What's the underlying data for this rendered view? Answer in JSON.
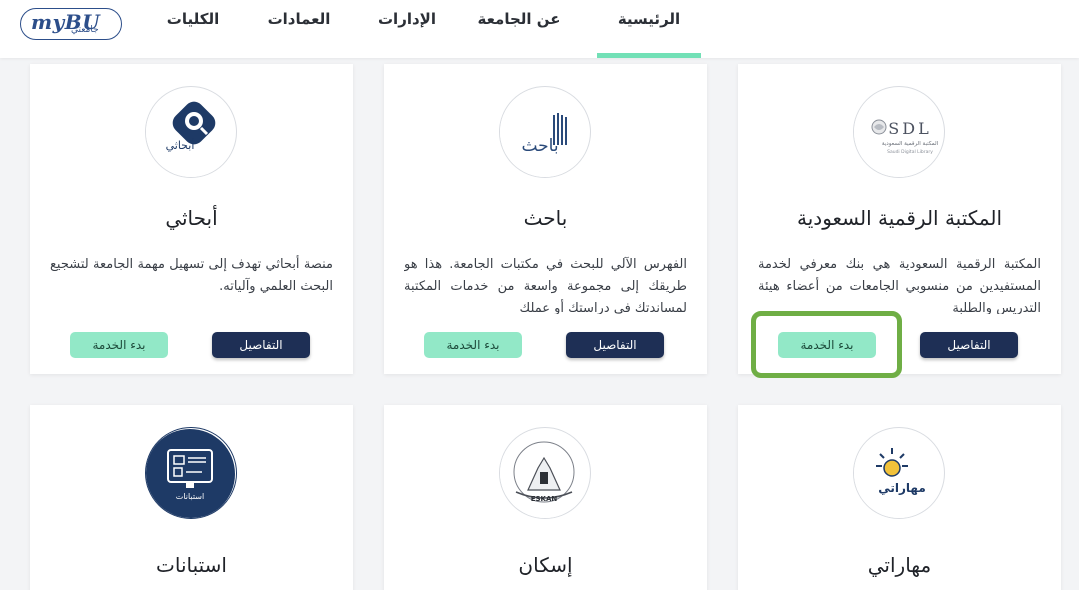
{
  "logo": {
    "main": "myBU",
    "sub": "جامعتي"
  },
  "nav": {
    "home": "الرئيسية",
    "about": "عن الجامعة",
    "departments": "الإدارات",
    "deanships": "العمادات",
    "colleges": "الكليات"
  },
  "buttons": {
    "details": "التفاصيل",
    "start": "بدء الخدمة"
  },
  "cards": [
    {
      "title": "المكتبة الرقمية السعودية",
      "desc": "المكتبة الرقمية السعودية هي بنك معرفي لخدمة المستفيدين من منسوبي الجامعات من أعضاء هيئة التدريس والطلبة",
      "logo_text": "SDL",
      "logo_sub": "المكتبة الرقمية السعودية",
      "logo_en": "Saudi Digital Library"
    },
    {
      "title": "باحث",
      "desc": "الفهرس الآلي للبحث في مكتبات الجامعة. هذا هو طريقك إلى مجموعة واسعة من خدمات المكتبة لمساندتك في دراستك أو عملك",
      "logo_text": "باحث"
    },
    {
      "title": "أبحاثي",
      "desc": "منصة أبحاثي تهدف إلى تسهيل مهمة الجامعة لتشجيع البحث العلمي وآلياته.",
      "logo_text": "أبحاثي"
    },
    {
      "title": "مهاراتي",
      "logo_text": "مهاراتي"
    },
    {
      "title": "إسكان",
      "logo_text": "ESKAN",
      "logo_ar": "اسكان"
    },
    {
      "title": "استبانات",
      "logo_text": "استبانات"
    }
  ],
  "colors": {
    "accent": "#72e0b6",
    "navy": "#1e2f55",
    "mint": "#92e8c7",
    "highlight": "#6fae45"
  }
}
